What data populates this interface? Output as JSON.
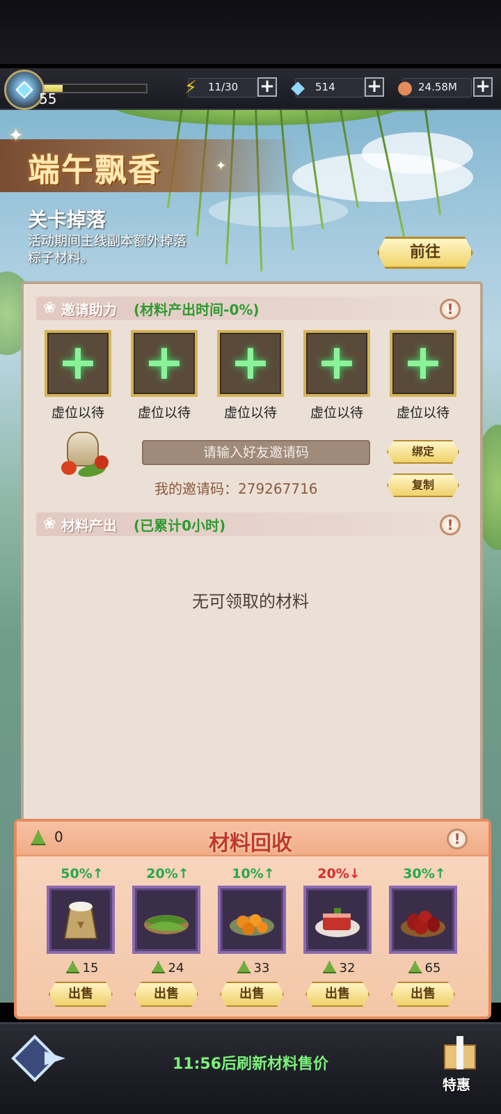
{
  "resources": {
    "level": "55",
    "xp_fraction": 0.2,
    "energy": "11/30",
    "gems": "514",
    "gold": "24.58M"
  },
  "event": {
    "title": "端午飘香",
    "stage_drop_title": "关卡掉落",
    "stage_drop_desc": "活动期间主线副本额外掉落粽子材料。",
    "goto_label": "前往"
  },
  "invite": {
    "section_label": "邀请助力",
    "section_hint": "(材料产出时间-0%)",
    "slots": [
      {
        "label": "虚位以待"
      },
      {
        "label": "虚位以待"
      },
      {
        "label": "虚位以待"
      },
      {
        "label": "虚位以待"
      },
      {
        "label": "虚位以待"
      }
    ],
    "input_placeholder": "请输入好友邀请码",
    "my_code_text": "我的邀请码：279267716",
    "bind_label": "绑定",
    "copy_label": "复制"
  },
  "output": {
    "section_label": "材料产出",
    "section_hint": "(已累计0小时)",
    "empty_text": "无可领取的材料"
  },
  "recycle": {
    "title": "材料回收",
    "zongzi_count": "0",
    "items": [
      {
        "name": "rice-sack",
        "pct": "50%↑",
        "dir": "up",
        "price": "15",
        "sell": "出售"
      },
      {
        "name": "bamboo-leaves",
        "pct": "20%↑",
        "dir": "up",
        "price": "24",
        "sell": "出售"
      },
      {
        "name": "salted-egg-yolks",
        "pct": "10%↑",
        "dir": "up",
        "price": "33",
        "sell": "出售"
      },
      {
        "name": "braised-pork",
        "pct": "20%↓",
        "dir": "down",
        "price": "32",
        "sell": "出售"
      },
      {
        "name": "red-dates",
        "pct": "30%↑",
        "dir": "up",
        "price": "65",
        "sell": "出售"
      }
    ]
  },
  "footer": {
    "refresh_text": "11:56后刷新材料售价",
    "special_label": "特惠"
  }
}
